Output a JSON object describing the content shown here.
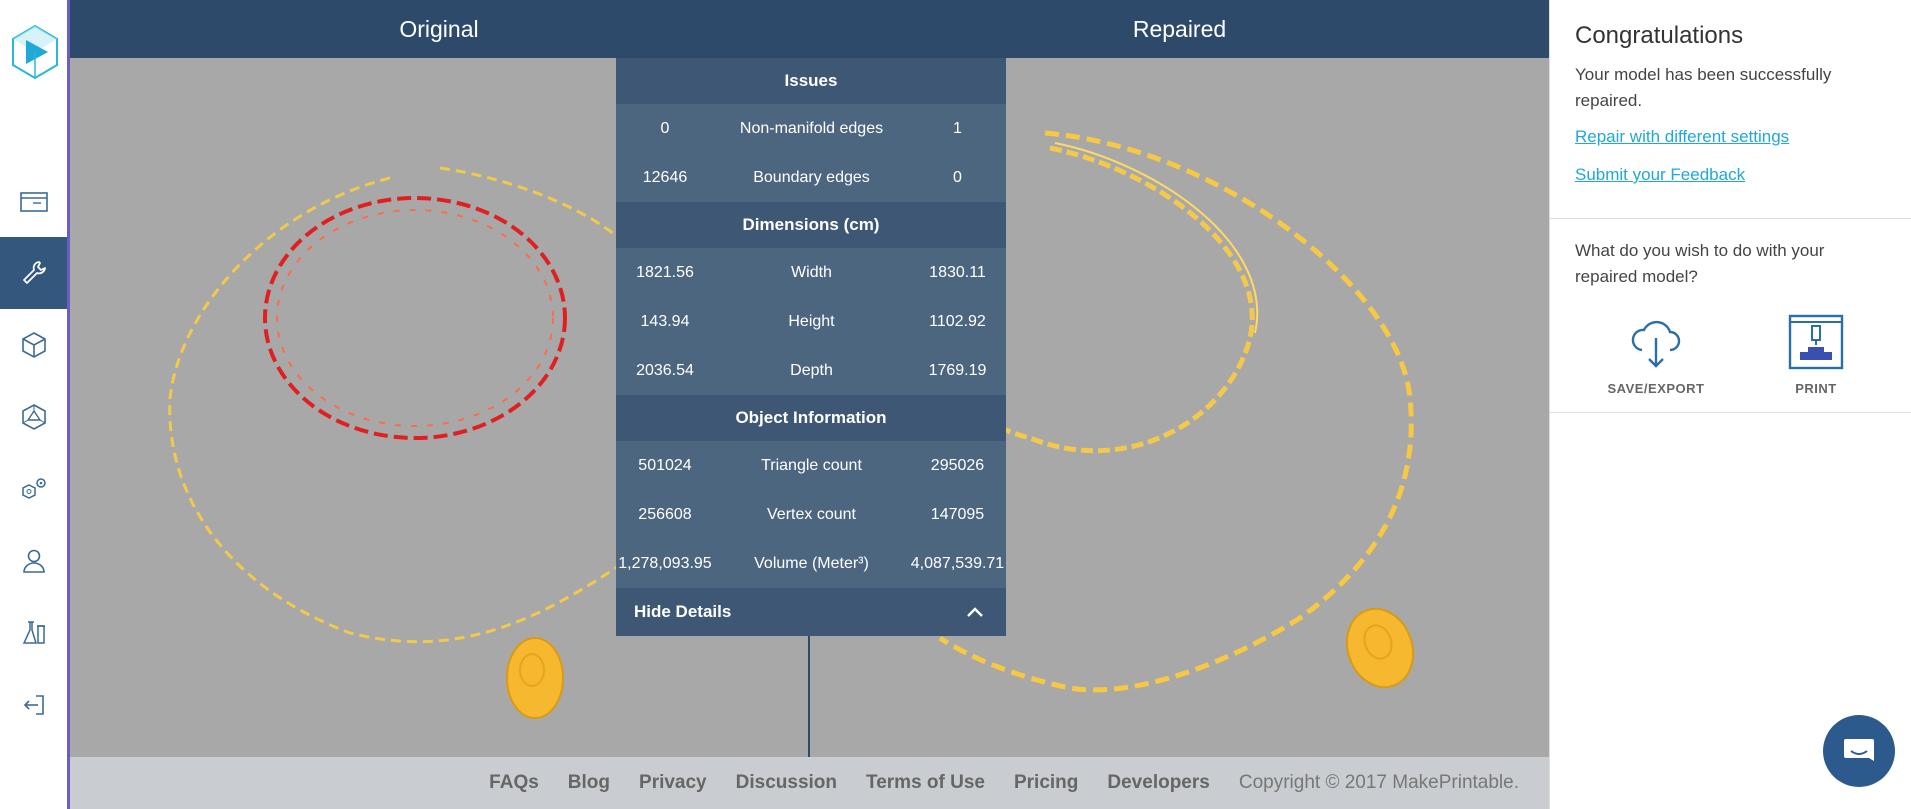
{
  "rail": {
    "logo_icon": "play-cube-logo",
    "items": [
      {
        "name": "sidebar-item-dashboard",
        "icon": "card-icon",
        "active": false
      },
      {
        "name": "sidebar-item-repair",
        "icon": "wrench-icon",
        "active": true
      },
      {
        "name": "sidebar-item-models",
        "icon": "cube-icon",
        "active": false
      },
      {
        "name": "sidebar-item-shapes",
        "icon": "polyhedron-icon",
        "active": false
      },
      {
        "name": "sidebar-item-settings",
        "icon": "gears-icon",
        "active": false
      },
      {
        "name": "sidebar-item-account",
        "icon": "user-icon",
        "active": false
      },
      {
        "name": "sidebar-item-labs",
        "icon": "flask-icon",
        "active": false
      },
      {
        "name": "sidebar-item-logout",
        "icon": "logout-icon",
        "active": false
      }
    ]
  },
  "viewer": {
    "original_label": "Original",
    "repaired_label": "Repaired"
  },
  "details": {
    "issues_title": "Issues",
    "issues": [
      {
        "original": "0",
        "label": "Non-manifold edges",
        "repaired": "1"
      },
      {
        "original": "12646",
        "label": "Boundary edges",
        "repaired": "0"
      }
    ],
    "dimensions_title": "Dimensions (cm)",
    "dimensions": [
      {
        "original": "1821.56",
        "label": "Width",
        "repaired": "1830.11"
      },
      {
        "original": "143.94",
        "label": "Height",
        "repaired": "1102.92"
      },
      {
        "original": "2036.54",
        "label": "Depth",
        "repaired": "1769.19"
      }
    ],
    "object_title": "Object Information",
    "object": [
      {
        "original": "501024",
        "label": "Triangle count",
        "repaired": "295026"
      },
      {
        "original": "256608",
        "label": "Vertex count",
        "repaired": "147095"
      },
      {
        "original": "1,278,093.95",
        "label": "Volume (Meter³)",
        "repaired": "4,087,539.71"
      }
    ],
    "hide_label": "Hide Details"
  },
  "footer": {
    "links": [
      "FAQs",
      "Blog",
      "Privacy",
      "Discussion",
      "Terms of Use",
      "Pricing",
      "Developers"
    ],
    "copyright": "Copyright © 2017 MakePrintable."
  },
  "side": {
    "title": "Congratulations",
    "message": "Your model has been successfully repaired.",
    "repair_link": "Repair with different settings",
    "feedback_link": "Submit your Feedback",
    "question": "What do you wish to do with your repaired model?",
    "save_label": "SAVE/EXPORT",
    "print_label": "PRINT"
  },
  "colors": {
    "header": "#2d4a6b",
    "panel": "#4d6680",
    "accent": "#1fa8d8",
    "chain_gold": "#f2c94c",
    "dna_red": "#e02020"
  }
}
